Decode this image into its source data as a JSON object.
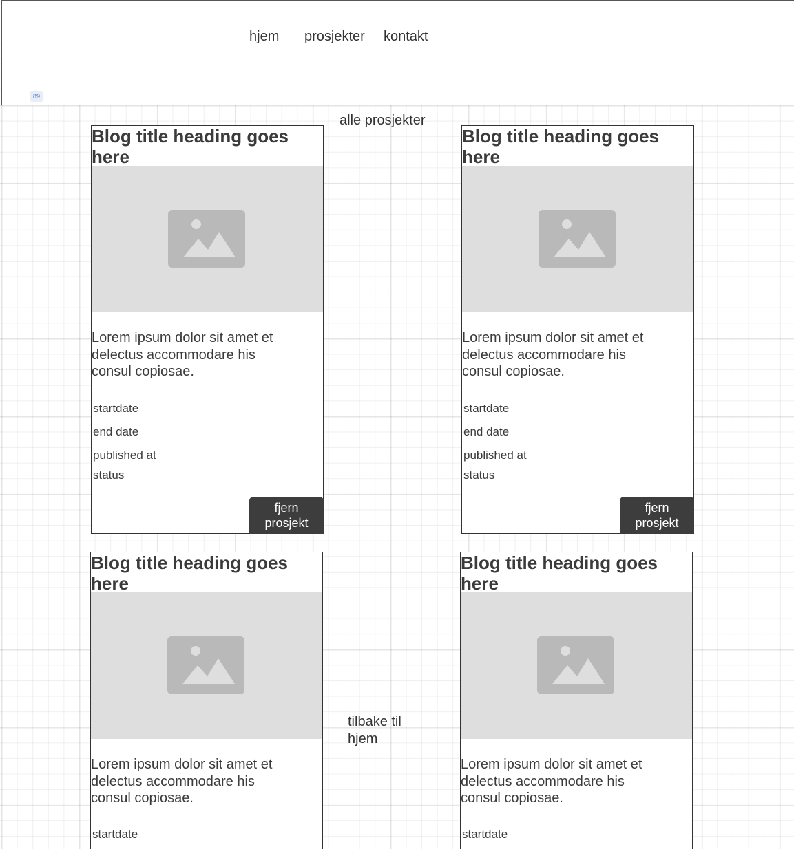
{
  "nav": {
    "items": [
      {
        "label": "hjem"
      },
      {
        "label": "prosjekter"
      },
      {
        "label": "kontakt"
      }
    ]
  },
  "badge_text": "89",
  "section_title": "alle prosjekter",
  "back_link": "tilbake til hjem",
  "image_icon": "image-placeholder-icon",
  "colors": {
    "image_placeholder_bg": "#dedede",
    "image_icon": "#b9b9b9",
    "button_bg": "#3d3d3d",
    "header_accent_line": "#4fd8d8"
  },
  "cards": [
    {
      "title": "Blog title heading goes here",
      "text": "Lorem ipsum dolor sit amet et delectus accommodare his consul copiosae.",
      "startdate": "startdate",
      "end_date": "end date",
      "published_at": "published at",
      "status": "status",
      "button": "fjern prosjekt"
    },
    {
      "title": "Blog title heading goes here",
      "text": "Lorem ipsum dolor sit amet et delectus accommodare his consul copiosae.",
      "startdate": "startdate",
      "end_date": "end date",
      "published_at": "published at",
      "status": "status",
      "button": "fjern prosjekt"
    },
    {
      "title": "Blog title heading goes here",
      "text": "Lorem ipsum dolor sit amet et delectus accommodare his consul copiosae.",
      "startdate": "startdate"
    },
    {
      "title": "Blog title heading goes here",
      "text": "Lorem ipsum dolor sit amet et delectus accommodare his consul copiosae.",
      "startdate": "startdate"
    }
  ]
}
